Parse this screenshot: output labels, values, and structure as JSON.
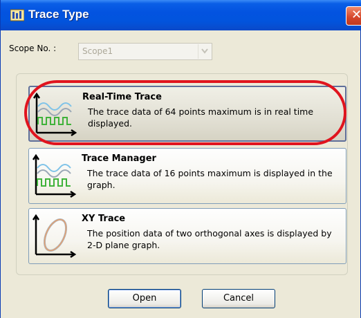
{
  "window": {
    "title": "Trace Type"
  },
  "scope": {
    "label": "Scope No. :",
    "value": "Scope1"
  },
  "options": [
    {
      "title": "Real-Time Trace",
      "description": "The trace data of 64 points maximum is in real time displayed.",
      "icon": "waveform-trace-icon",
      "selected": true
    },
    {
      "title": "Trace Manager",
      "description": "The trace data of 16 points maximum is displayed in the graph.",
      "icon": "waveform-trace-icon",
      "selected": false
    },
    {
      "title": "XY Trace",
      "description": "The position data of two orthogonal axes is displayed by 2-D plane graph.",
      "icon": "xy-ellipse-icon",
      "selected": false
    }
  ],
  "buttons": {
    "open": "Open",
    "cancel": "Cancel"
  },
  "colors": {
    "annotation": "#e0141e",
    "titlebar": "#0353e0"
  }
}
